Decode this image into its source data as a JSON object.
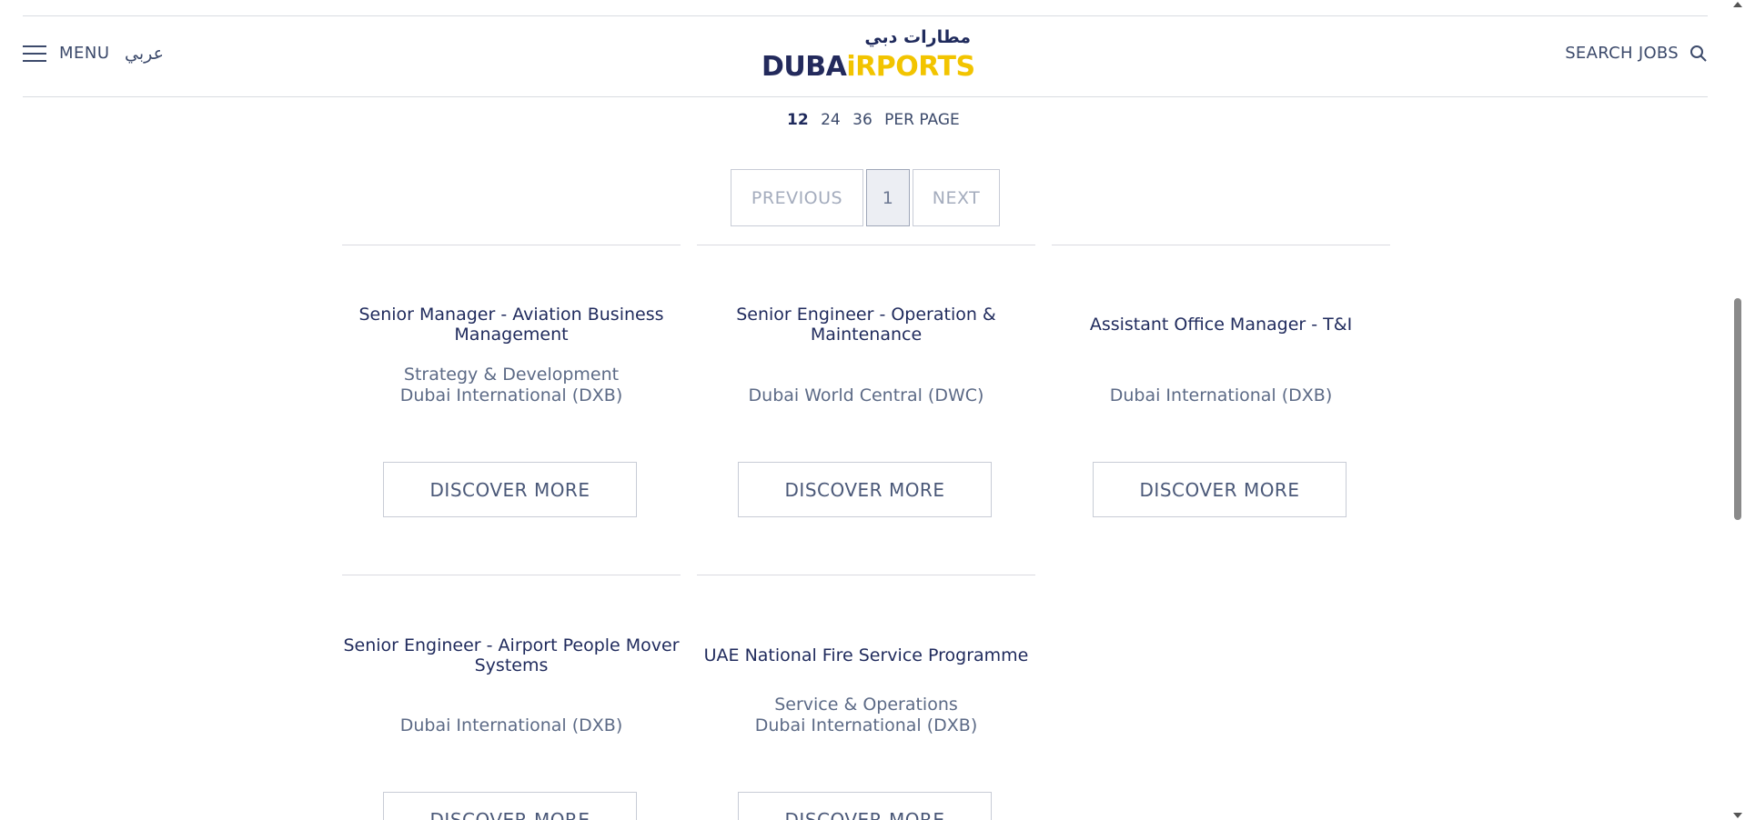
{
  "header": {
    "menu_label": "MENU",
    "lang_label": "عربي",
    "logo_arabic": "مطارات دبي",
    "logo_dubai": "DUBA",
    "logo_airports": "iRPORTS",
    "search_label": "SEARCH JOBS",
    "colors": {
      "navy": "#232a5c",
      "yellow": "#f2c400"
    }
  },
  "per_page": {
    "options": [
      "12",
      "24",
      "36"
    ],
    "active": "12",
    "suffix": "PER PAGE"
  },
  "pagination": {
    "previous": "PREVIOUS",
    "current": "1",
    "next": "NEXT"
  },
  "jobs": [
    {
      "title_lines": [
        "Senior Manager - Aviation Business",
        "Management"
      ],
      "sub_lines": [
        "Strategy & Development",
        "Dubai International (DXB)"
      ],
      "cta": "DISCOVER MORE"
    },
    {
      "title_lines": [
        "Senior Engineer - Operation &",
        "Maintenance"
      ],
      "sub_lines": [
        "Dubai World Central (DWC)"
      ],
      "cta": "DISCOVER MORE"
    },
    {
      "title_lines": [
        "Assistant Office Manager - T&I"
      ],
      "sub_lines": [
        "Dubai International (DXB)"
      ],
      "cta": "DISCOVER MORE"
    },
    {
      "title_lines": [
        "Senior Engineer - Airport People Mover",
        "Systems"
      ],
      "sub_lines": [
        "Dubai International (DXB)"
      ],
      "cta": "DISCOVER MORE"
    },
    {
      "title_lines": [
        "UAE National Fire Service Programme"
      ],
      "sub_lines": [
        "Service & Operations",
        "Dubai International (DXB)"
      ],
      "cta": "DISCOVER MORE"
    }
  ]
}
